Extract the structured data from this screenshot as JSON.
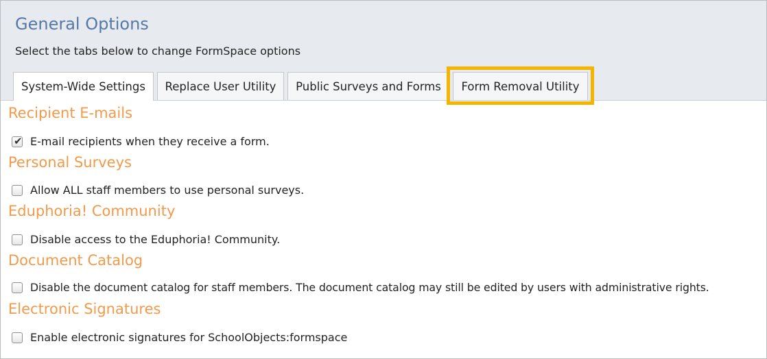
{
  "header": {
    "title": "General Options",
    "subtitle": "Select the tabs below to change FormSpace options"
  },
  "tabs": [
    {
      "label": "System-Wide Settings",
      "active": true
    },
    {
      "label": "Replace User Utility",
      "active": false
    },
    {
      "label": "Public Surveys and Forms",
      "active": false
    },
    {
      "label": "Form Removal Utility",
      "active": false,
      "highlighted": true
    }
  ],
  "highlight_color": "#f5b400",
  "accent_color": "#f19a4b",
  "sections": [
    {
      "title": "Recipient E-mails",
      "option": {
        "label": "E-mail recipients when they receive a form.",
        "checked": true
      }
    },
    {
      "title": "Personal Surveys",
      "option": {
        "label": "Allow ALL staff members to use personal surveys.",
        "checked": false
      }
    },
    {
      "title": "Eduphoria! Community",
      "option": {
        "label": "Disable access to the Eduphoria! Community.",
        "checked": false
      }
    },
    {
      "title": "Document Catalog",
      "option": {
        "label": "Disable the document catalog for staff members. The document catalog may still be edited by users with administrative rights.",
        "checked": false
      }
    },
    {
      "title": "Electronic Signatures",
      "option": {
        "label": "Enable electronic signatures for SchoolObjects:formspace",
        "checked": false
      }
    }
  ]
}
